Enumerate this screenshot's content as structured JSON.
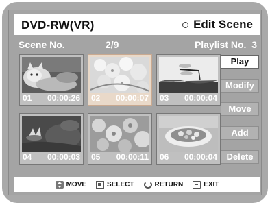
{
  "header": {
    "device": "DVD-RW(VR)",
    "screen_title": "Edit Scene"
  },
  "info": {
    "scene_label": "Scene No.",
    "scene_value": "2/9",
    "playlist_label": "Playlist No.",
    "playlist_value": "3"
  },
  "thumbnails": [
    {
      "index": "01",
      "time": "00:00:26",
      "subject": "cat",
      "selected": false
    },
    {
      "index": "02",
      "time": "00:00:07",
      "subject": "blossoms",
      "selected": true
    },
    {
      "index": "03",
      "time": "00:00:04",
      "subject": "dragonfly",
      "selected": false
    },
    {
      "index": "04",
      "time": "00:00:03",
      "subject": "lily",
      "selected": false
    },
    {
      "index": "05",
      "time": "00:00:11",
      "subject": "flowers",
      "selected": false
    },
    {
      "index": "06",
      "time": "00:00:04",
      "subject": "dish",
      "selected": false
    }
  ],
  "buttons": [
    "Play",
    "Modify",
    "Move",
    "Add",
    "Delete"
  ],
  "active_button": "Play",
  "footer": {
    "move": "MOVE",
    "select": "SELECT",
    "return": "RETURN",
    "exit": "EXIT"
  },
  "colors": {
    "panel_gray": "#a4a4a4",
    "bezel_gray": "#a9a9a9",
    "selected_thumb": "#e9d9c9",
    "bar_white": "#ffffff"
  }
}
